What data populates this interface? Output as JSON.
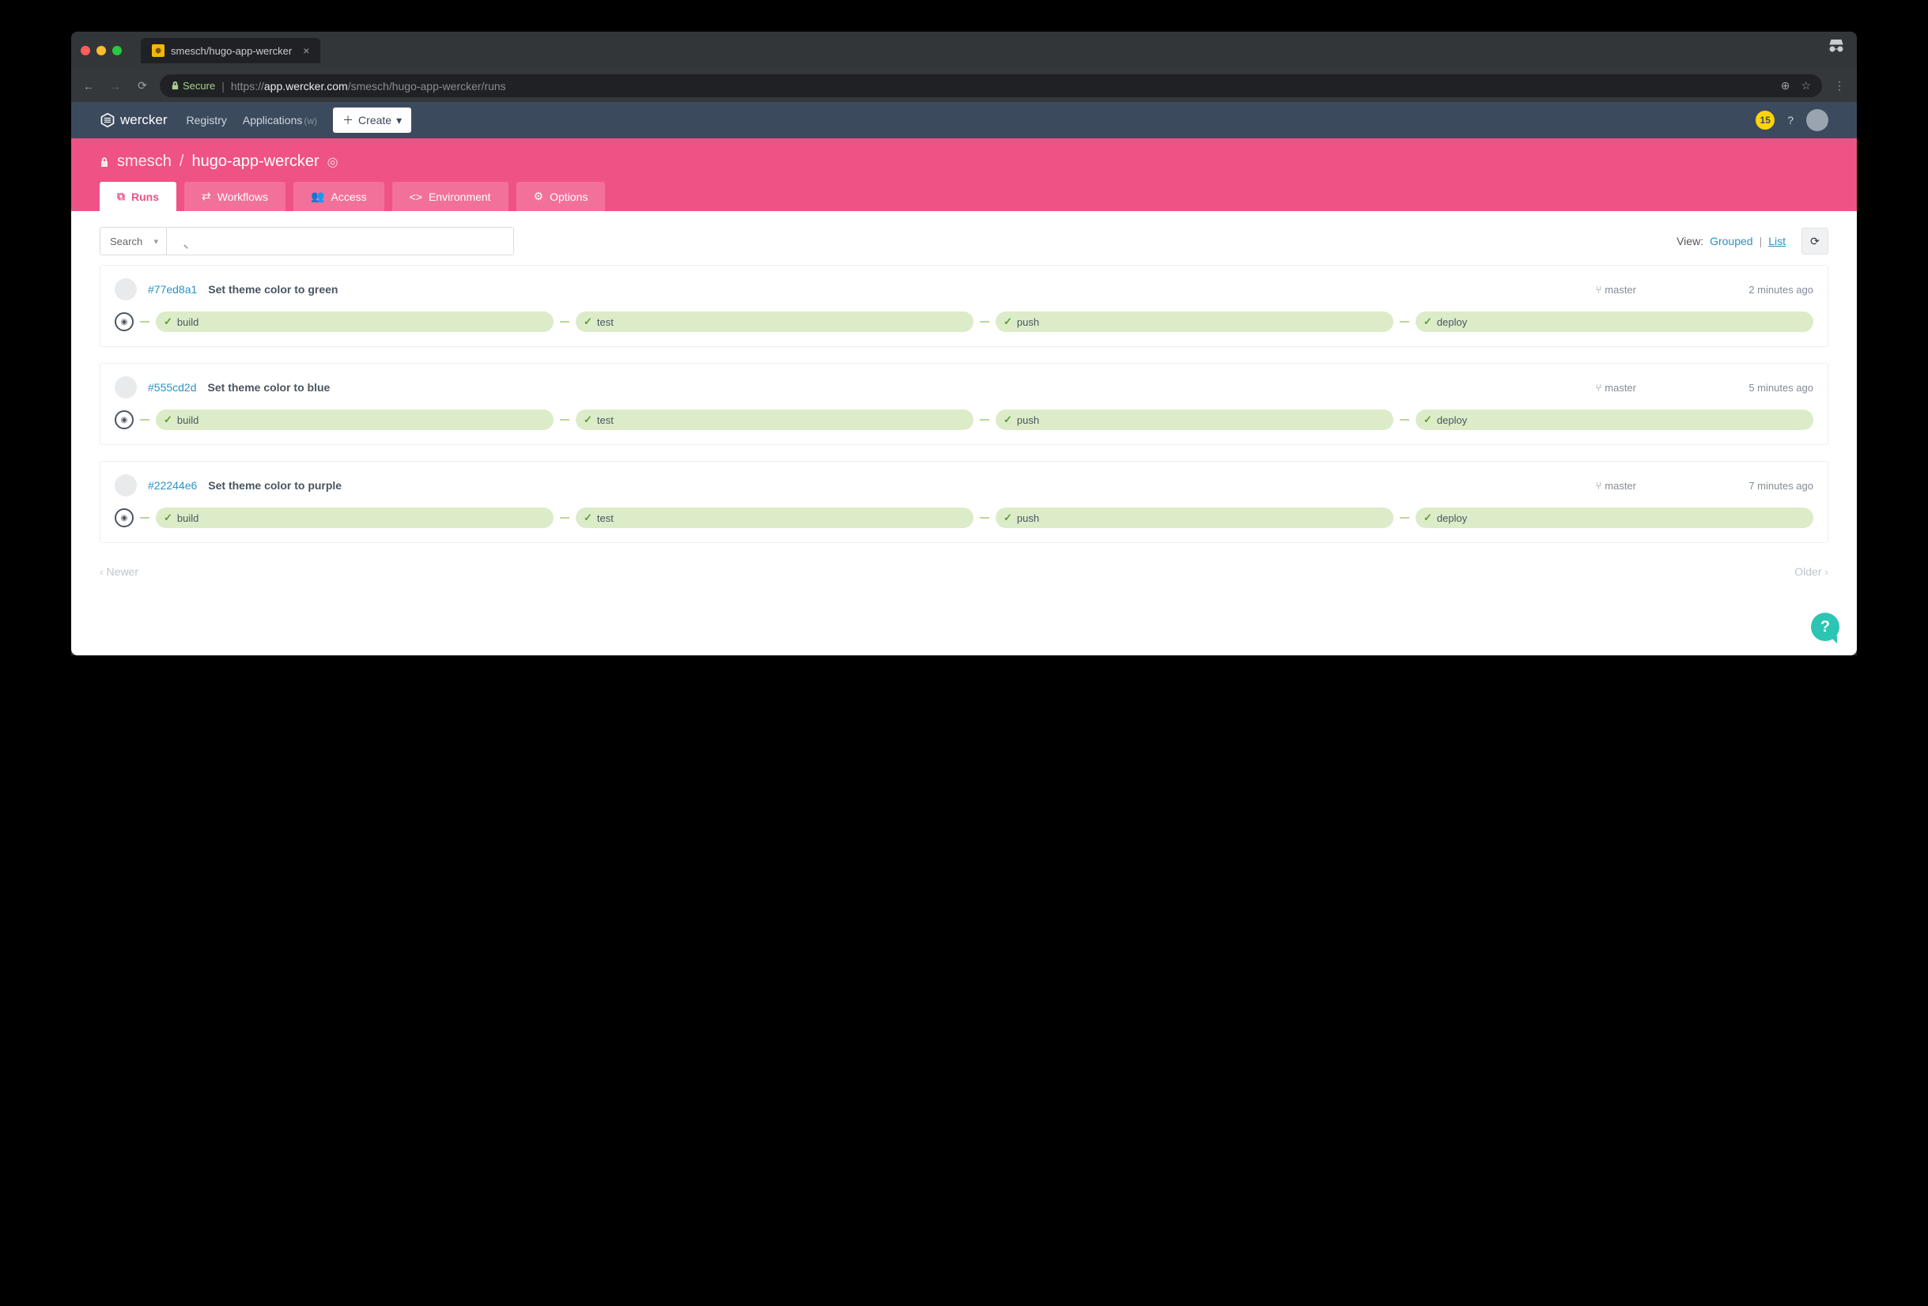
{
  "browser": {
    "tab_title": "smesch/hugo-app-wercker",
    "url_protocol": "https://",
    "url_host": "app.wercker.com",
    "url_path": "/smesch/hugo-app-wercker/runs",
    "secure_label": "Secure"
  },
  "topnav": {
    "brand": "wercker",
    "links": {
      "registry": "Registry",
      "applications": "Applications",
      "applications_suffix": "(w)"
    },
    "create_label": "Create",
    "notif_count": "15",
    "help_glyph": "?"
  },
  "breadcrumb": {
    "owner": "smesch",
    "sep": "/",
    "app": "hugo-app-wercker"
  },
  "subtabs": {
    "runs": "Runs",
    "workflows": "Workflows",
    "access": "Access",
    "environment": "Environment",
    "options": "Options"
  },
  "toolbar": {
    "search_mode": "Search",
    "search_placeholder": "",
    "view_label": "View:",
    "view_grouped": "Grouped",
    "view_list": "List"
  },
  "runs": [
    {
      "hash": "#77ed8a1",
      "message": "Set theme color to green",
      "branch": "master",
      "time": "2 minutes ago",
      "steps": [
        "build",
        "test",
        "push",
        "deploy"
      ]
    },
    {
      "hash": "#555cd2d",
      "message": "Set theme color to blue",
      "branch": "master",
      "time": "5 minutes ago",
      "steps": [
        "build",
        "test",
        "push",
        "deploy"
      ]
    },
    {
      "hash": "#22244e6",
      "message": "Set theme color to purple",
      "branch": "master",
      "time": "7 minutes ago",
      "steps": [
        "build",
        "test",
        "push",
        "deploy"
      ]
    }
  ],
  "pager": {
    "newer": "‹ Newer",
    "older": "Older ›"
  }
}
